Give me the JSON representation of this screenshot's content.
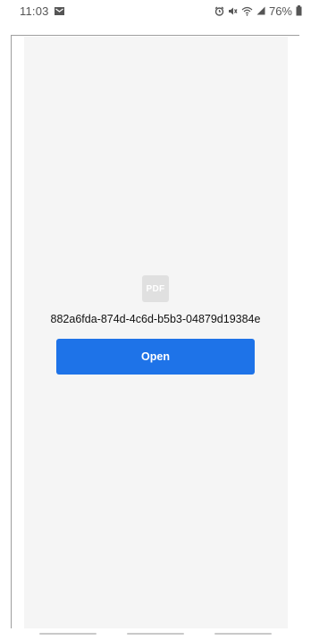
{
  "status_bar": {
    "time": "11:03",
    "battery_percent": "76%",
    "icons": [
      "mail-icon",
      "alarm-icon",
      "mute-icon",
      "wifi-icon",
      "signal-icon",
      "battery-icon"
    ]
  },
  "viewer": {
    "file_icon_label": "PDF",
    "file_name": "882a6fda-874d-4c6d-b5b3-04879d19384e",
    "open_label": "Open"
  },
  "colors": {
    "accent": "#1e73e8",
    "canvas": "#f5f5f5",
    "pdf_icon": "#e0e0e0"
  }
}
